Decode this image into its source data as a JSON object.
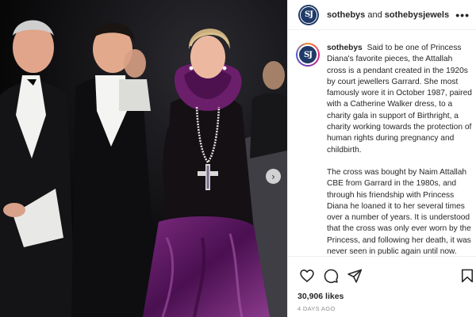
{
  "post": {
    "header": {
      "account": "sothebys",
      "conjunction": "and",
      "collaborator": "sothebysjewels",
      "avatar_text": "SJ",
      "more_icon": "more-horizontal-icon"
    },
    "caption": {
      "username": "sothebys",
      "paragraph_1": "Said to be one of Princess Diana's favorite pieces, the Attallah cross is a pendant created in the 1920s by court jewellers Garrard. She most famously wore it in October 1987, paired with a Catherine Walker dress, to a charity gala in support of Birthright, a charity working towards the protection of human rights during pregnancy and childbirth.",
      "paragraph_2": "The cross was bought by Naim Attallah CBE from Garrard in the 1980s, and through his friendship with Princess Diana he loaned it to her several times over a number of years. It is understood that the cross was only ever worn by the Princess, and following her death, it was never seen in public again until now."
    },
    "photo": {
      "next_icon": "chevron-right-icon",
      "next_glyph": "›"
    },
    "actions": {
      "like_icon": "heart-icon",
      "comment_icon": "comment-icon",
      "share_icon": "send-icon",
      "save_icon": "bookmark-icon"
    },
    "likes": "30,906 likes",
    "date": "4 DAYS AGO"
  },
  "colors": {
    "avatar_bg": "#1f3a68",
    "text": "#262626",
    "muted": "#8e8e8e",
    "dress_purple": "#5a1a5c"
  }
}
